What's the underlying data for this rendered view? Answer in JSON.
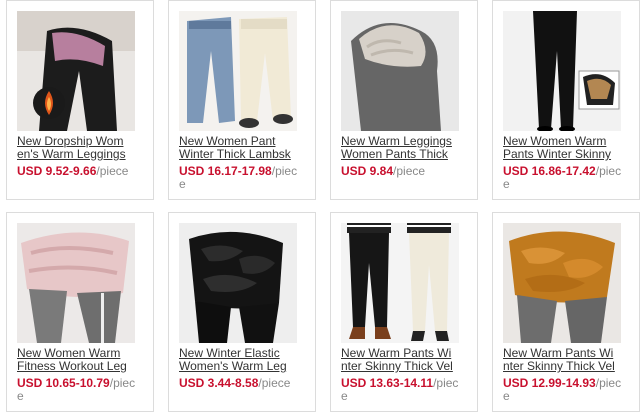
{
  "products": [
    {
      "title_lines": [
        "New Dropship Wom",
        "en's Warm Leggings"
      ],
      "price": "USD 9.52-9.66",
      "unit": "/piece"
    },
    {
      "title_lines": [
        "New Women Pant",
        "Winter Thick Lambsk"
      ],
      "price": "USD 16.17-17.98",
      "unit": "/piece"
    },
    {
      "title_lines": [
        "New Warm Leggings",
        "Women Pants Thick"
      ],
      "price": "USD 9.84",
      "unit": "/piece"
    },
    {
      "title_lines": [
        "New Women Warm",
        "Pants Winter Skinny"
      ],
      "price": "USD 16.86-17.42",
      "unit": "/piece"
    },
    {
      "title_lines": [
        "New Women Warm",
        "Fitness Workout Leg"
      ],
      "price": "USD 10.65-10.79",
      "unit": "/piece"
    },
    {
      "title_lines": [
        "New Winter Elastic",
        "Women's Warm Leg"
      ],
      "price": "USD 3.44-8.58",
      "unit": "/piece"
    },
    {
      "title_lines": [
        "New Warm Pants Wi",
        "nter Skinny Thick Vel"
      ],
      "price": "USD 13.63-14.11",
      "unit": "/piece"
    },
    {
      "title_lines": [
        "New Warm Pants Wi",
        "nter Skinny Thick Vel"
      ],
      "price": "USD 12.99-14.93",
      "unit": "/piece"
    }
  ],
  "colors": {
    "price": "#c8102e",
    "unit": "#888888",
    "title": "#333333",
    "border": "#dcdcdc"
  }
}
